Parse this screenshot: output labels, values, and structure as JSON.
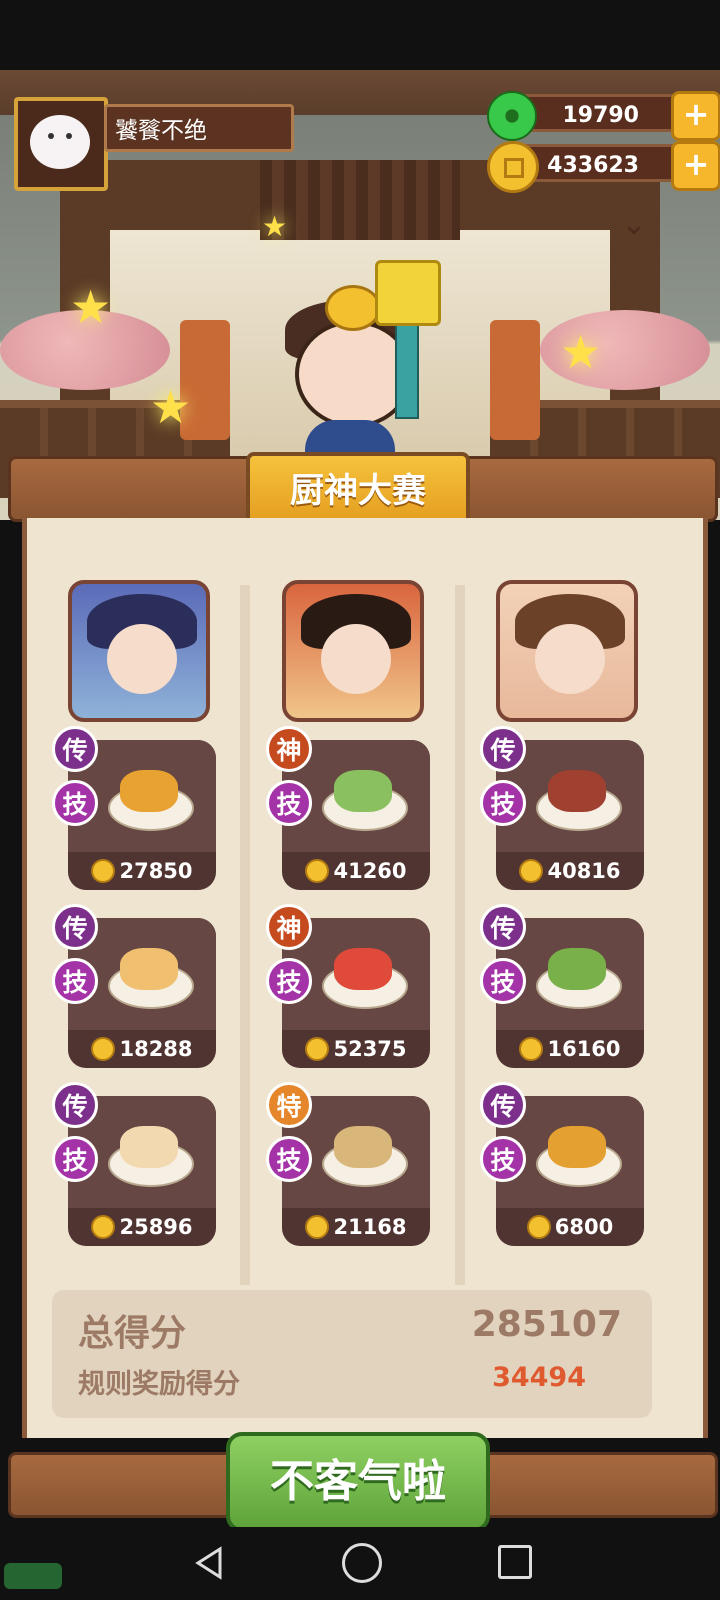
{
  "player": {
    "name": "饕餮不绝",
    "avatar_icon": "cat-avatar-icon"
  },
  "currencies": [
    {
      "name": "jade",
      "icon": "jade-coin-icon",
      "amount": "19790",
      "add_label": "+"
    },
    {
      "name": "gold",
      "icon": "gold-coin-icon",
      "amount": "433623",
      "add_label": "+"
    }
  ],
  "banner": {
    "title": "厨神大赛"
  },
  "contestants": [
    {
      "portrait_icon": "chef-portrait-blue-hair",
      "dishes": [
        {
          "grade": "传",
          "grade_color": "#7d2f8c",
          "skill": "技",
          "price": "27850",
          "food_color": "#e8a231"
        },
        {
          "grade": "传",
          "grade_color": "#7d2f8c",
          "skill": "技",
          "price": "18288",
          "food_color": "#f0c070"
        },
        {
          "grade": "传",
          "grade_color": "#7d2f8c",
          "skill": "技",
          "price": "25896",
          "food_color": "#f3d9b0"
        }
      ]
    },
    {
      "portrait_icon": "chef-portrait-opera-headdress",
      "dishes": [
        {
          "grade": "神",
          "grade_color": "#c54b1f",
          "skill": "技",
          "price": "41260",
          "food_color": "#8ac060"
        },
        {
          "grade": "神",
          "grade_color": "#c54b1f",
          "skill": "技",
          "price": "52375",
          "food_color": "#e04a3a"
        },
        {
          "grade": "特",
          "grade_color": "#e6862a",
          "skill": "技",
          "price": "21168",
          "food_color": "#d9b67a"
        }
      ]
    },
    {
      "portrait_icon": "chef-portrait-brown-hair",
      "dishes": [
        {
          "grade": "传",
          "grade_color": "#7d2f8c",
          "skill": "技",
          "price": "40816",
          "food_color": "#a04030"
        },
        {
          "grade": "传",
          "grade_color": "#7d2f8c",
          "skill": "技",
          "price": "16160",
          "food_color": "#7ab04a"
        },
        {
          "grade": "传",
          "grade_color": "#7d2f8c",
          "skill": "技",
          "price": "6800",
          "food_color": "#e4a030"
        }
      ]
    }
  ],
  "score": {
    "total_label": "总得分",
    "total_value": "285107",
    "bonus_label": "规则奖励得分",
    "bonus_value": "34494",
    "bonus_color": "#e05a30"
  },
  "confirm_button": {
    "label": "不客气啦"
  },
  "nav": {
    "back_icon": "back-triangle-icon",
    "home_icon": "home-circle-icon",
    "recent_icon": "recent-square-icon"
  }
}
